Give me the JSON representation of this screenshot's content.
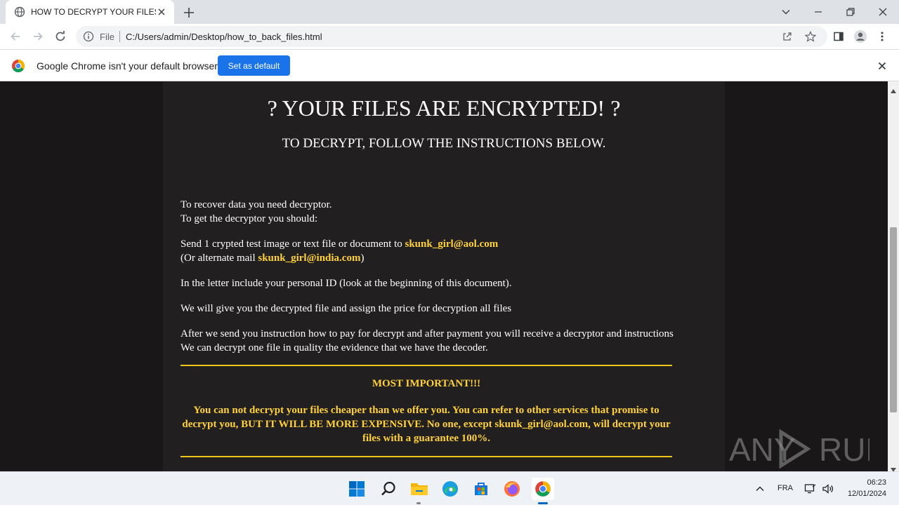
{
  "browser": {
    "tab": {
      "title": "HOW TO DECRYPT YOUR FILES",
      "icon": "globe-icon"
    },
    "omnibox": {
      "scheme_label": "File",
      "url": "C:/Users/admin/Desktop/how_to_back_files.html"
    },
    "infobar": {
      "message": "Google Chrome isn't your default browser",
      "button_label": "Set as default"
    }
  },
  "page": {
    "heading": "? YOUR FILES ARE ENCRYPTED! ?",
    "subheading": "TO DECRYPT, FOLLOW THE INSTRUCTIONS BELOW.",
    "intro_line1": "To recover data you need decryptor.",
    "intro_line2": "To get the decryptor you should:",
    "send_text": "Send 1 crypted test image or text file or document to ",
    "primary_email": "skunk_girl@aol.com",
    "alt_prefix": "(Or alternate mail ",
    "alt_email": "skunk_girl@india.com",
    "alt_suffix": ")",
    "letter_text": "In the letter include your personal ID (look at the beginning of this document).",
    "give_text": "We will give you the decrypted file and assign the price for decryption all files",
    "after_line1": "After we send you instruction how to pay for decrypt and after payment you will receive a decryptor and instructions",
    "after_line2": "We can decrypt one file in quality the evidence that we have the decoder.",
    "important_title": "MOST IMPORTANT!!!",
    "important_body": "You can not decrypt your files cheaper than we offer you. You can refer to other services that promise to decrypt you, BUT IT WILL BE MORE EXPENSIVE. No one, except skunk_girl@aol.com, will decrypt your files with a guarantee 100%."
  },
  "watermark": {
    "text": "ANY RUN"
  },
  "taskbar": {
    "language": "FRA",
    "time": "06:23",
    "date": "12/01/2024"
  },
  "colors": {
    "page_bg": "#191718",
    "panel_bg": "#221f20",
    "accent_yellow": "#ffd23c",
    "rule_color": "#f0c419",
    "chrome_blue": "#1a73e8"
  }
}
